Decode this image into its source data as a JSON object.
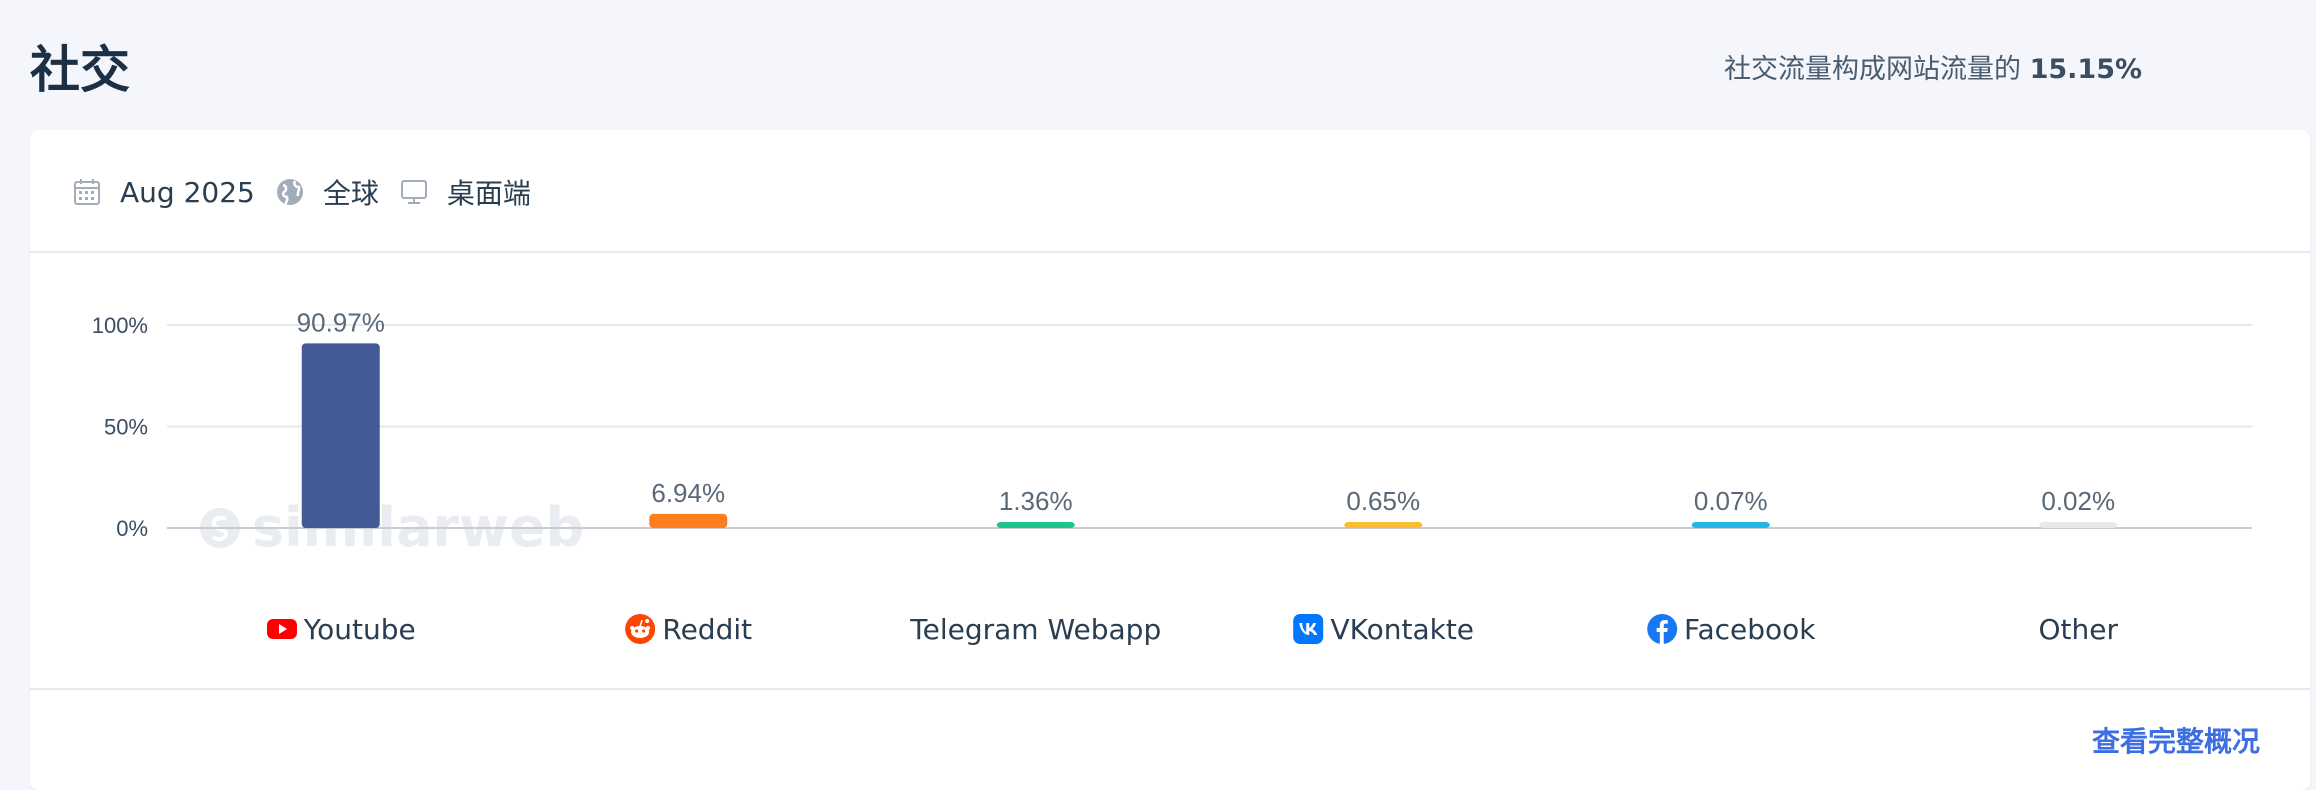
{
  "header": {
    "title": "社交",
    "summary_prefix": "社交流量构成网站流量的",
    "summary_value": "15.15%"
  },
  "filters": {
    "date": "Aug 2025",
    "region": "全球",
    "device": "桌面端",
    "icons": [
      "calendar-icon",
      "globe-icon",
      "desktop-icon"
    ]
  },
  "watermark": {
    "text": "similarweb"
  },
  "chart_data": {
    "type": "bar",
    "categories": [
      "Youtube",
      "Reddit",
      "Telegram Webapp",
      "VKontakte",
      "Facebook",
      "Other"
    ],
    "values": [
      90.97,
      6.94,
      1.36,
      0.65,
      0.07,
      0.02
    ],
    "value_labels": [
      "90.97%",
      "6.94%",
      "1.36%",
      "0.65%",
      "0.07%",
      "0.02%"
    ],
    "colors": [
      "#435a96",
      "#ff7f1e",
      "#1ec48f",
      "#fbbc2e",
      "#23b6e6",
      "#e6e8ec"
    ],
    "y_ticks": [
      "0%",
      "50%",
      "100%"
    ],
    "ylim": [
      0,
      100
    ],
    "grid": true,
    "legend_icons": [
      "youtube-icon",
      "reddit-icon",
      "",
      "vk-icon",
      "facebook-icon",
      ""
    ]
  },
  "footer": {
    "link": "查看完整概况"
  }
}
